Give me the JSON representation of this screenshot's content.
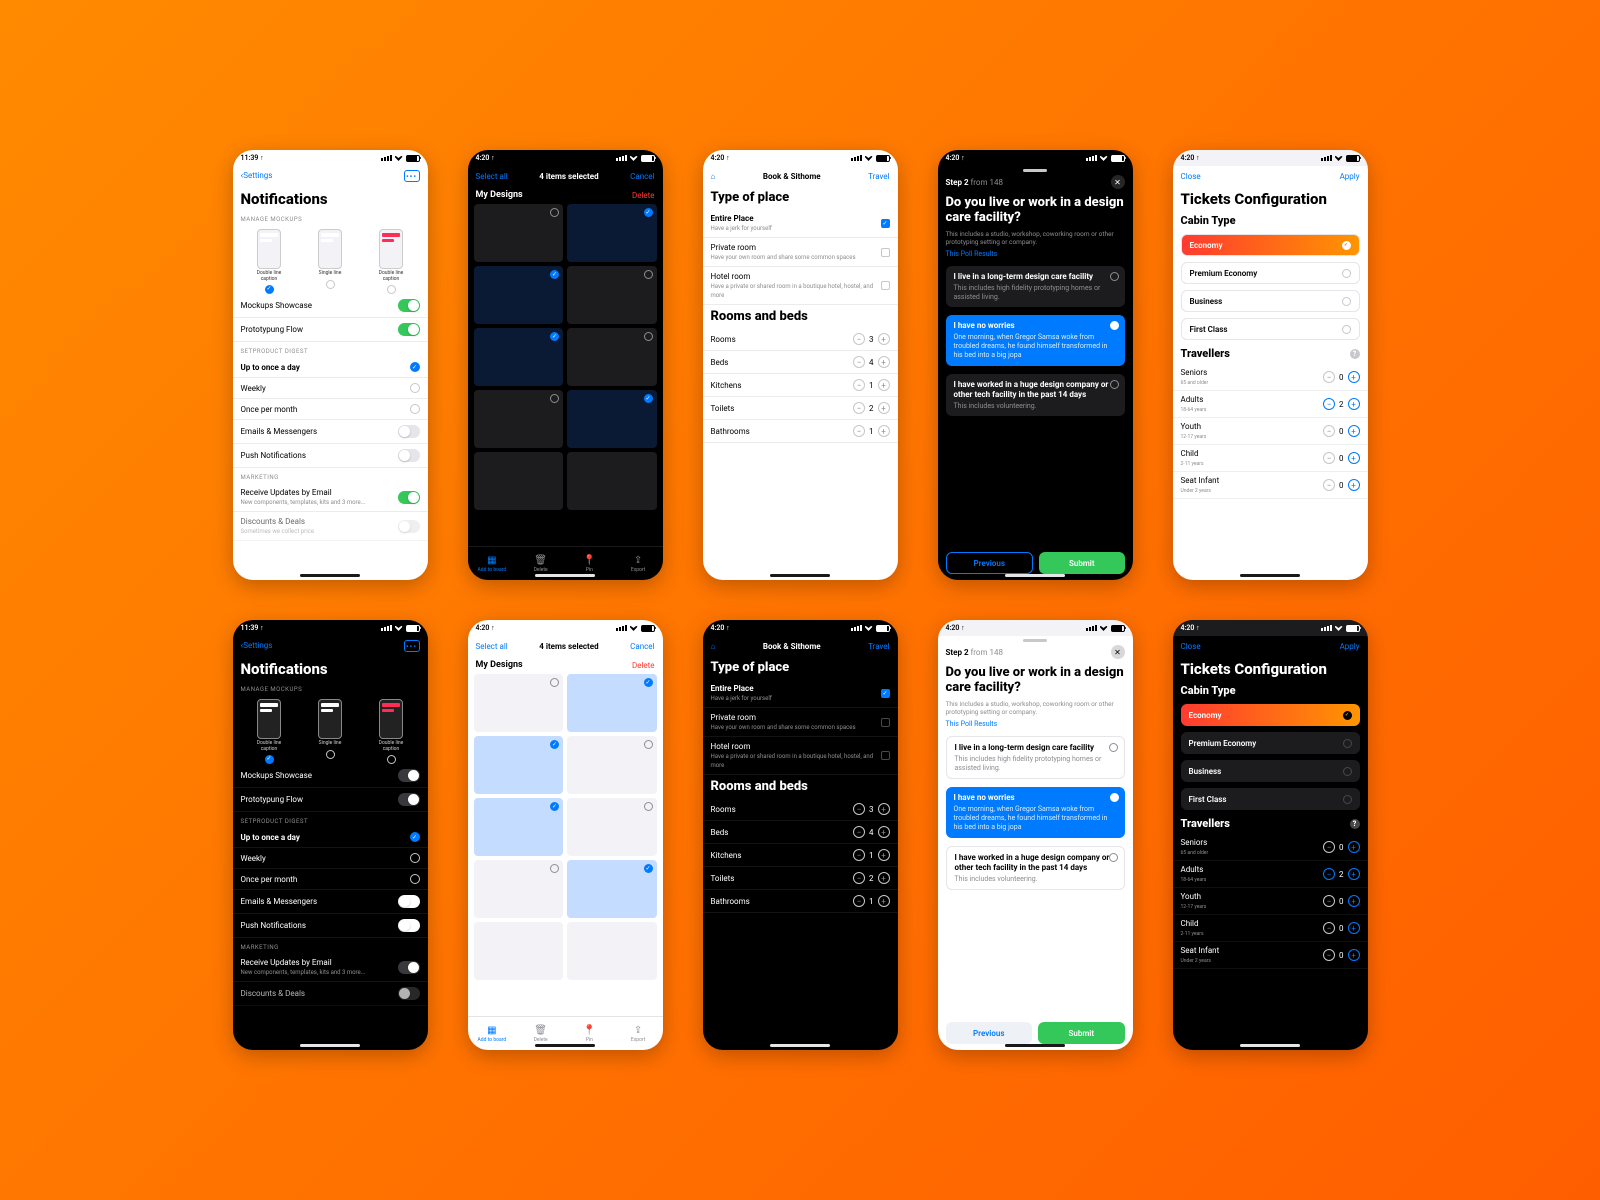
{
  "status": {
    "time1": "11:39 ↑",
    "time2": "4:20 ↑"
  },
  "s1": {
    "back": "Settings",
    "title": "Notifications",
    "sec_mockups": "MANAGE MOCKUPS",
    "mk1": "Double line caption",
    "mk2": "Single line",
    "mk3": "Double line caption",
    "showcase": "Mockups Showcase",
    "protoflow": "Prototypung Flow",
    "sec_digest": "SETPRODUCT DIGEST",
    "d1": "Up to once a day",
    "d2": "Weekly",
    "d3": "Once per month",
    "d4": "Emails & Messengers",
    "d5": "Push Notifications",
    "sec_marketing": "MARKETING",
    "m1": "Receive Updates by Email",
    "m1_sub": "New components, templates, kits and 3 more...",
    "m2": "Discounts & Deals",
    "m2_sub": "Sometimes we collect price"
  },
  "s2": {
    "select_all": "Select all",
    "count": "4 items selected",
    "cancel": "Cancel",
    "my_designs": "My Designs",
    "delete": "Delete",
    "tab1": "Add to board",
    "tab2": "Delete",
    "tab3": "Pin",
    "tab4": "Export"
  },
  "s3": {
    "app": "Book & Sithome",
    "travel": "Travel",
    "h1": "Type of place",
    "p1": "Entire Place",
    "p1_sub": "Have a jerk for yourself",
    "p2": "Private room",
    "p2_sub": "Have your own room and share some common spaces",
    "p3": "Hotel room",
    "p3_sub": "Have a private or shared room in a boutique hotel, hostel, and more",
    "h2": "Rooms and beds",
    "r1": "Rooms",
    "r1v": "3",
    "r2": "Beds",
    "r2v": "4",
    "r3": "Kitchens",
    "r3v": "1",
    "r4": "Toilets",
    "r4v": "2",
    "r5": "Bathrooms",
    "r5v": "1"
  },
  "s4": {
    "step": "Step 2",
    "from": " from 148",
    "q": "Do you live or work in a design care facility?",
    "q_sub": "This includes a studio, workshop, coworking room or other prototyping setting or company.",
    "link": "This Poll Results",
    "o1": "I live in a long-term design care facility",
    "o1_sub": "This includes high fidelity prototyping homes or assisted living.",
    "o2": "I have no worries",
    "o2_sub": "One morning, when Gregor Samsa woke from troubled dreams, he found himself transformed in his bed into a big jopa",
    "o3": "I have  worked in a huge design company or other tech facility in the past 14 days",
    "o3_sub": "This includes volunteering.",
    "prev": "Previous",
    "submit": "Submit"
  },
  "s5": {
    "close": "Close",
    "apply": "Apply",
    "title": "Tickets Configuration",
    "cabin_h": "Cabin Type",
    "c1": "Economy",
    "c2": "Premium Economy",
    "c3": "Business",
    "c4": "First Class",
    "trav_h": "Travellers",
    "t1": "Seniors",
    "t1_sub": "65 and older",
    "t1v": "0",
    "t2": "Adults",
    "t2_sub": "18-64 years",
    "t2v": "2",
    "t3": "Youth",
    "t3_sub": "12-17 years",
    "t3v": "0",
    "t4": "Child",
    "t4_sub": "2-11 years",
    "t4v": "0",
    "t5": "Seat Infant",
    "t5_sub": "Under 2 years",
    "t5v": "0"
  }
}
